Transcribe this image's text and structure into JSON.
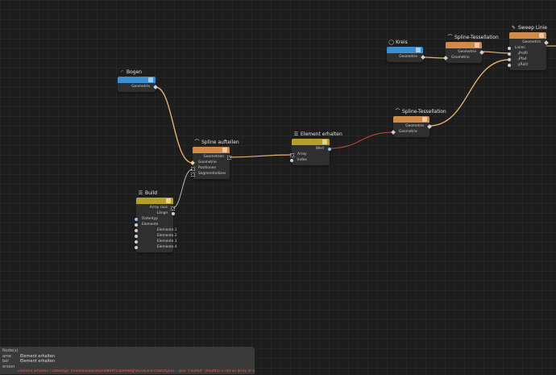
{
  "colors": {
    "geometry_header": "#d08a4a",
    "utility_header": "#b49f2a",
    "input_header": "#3a8fd0",
    "wire_geometry": "#e0b070",
    "wire_error": "#c04a40",
    "wire_neutral": "#b9b9b9"
  },
  "nodes": {
    "bogen": {
      "title": "Bogen",
      "icon": "arc-icon",
      "out_geometrie": "Geometrie"
    },
    "kreis": {
      "title": "Kreis",
      "icon": "circle-icon",
      "out_geometrie": "Geometrie"
    },
    "spline_tess_top": {
      "title": "Spline-Tessellation",
      "icon": "spline-icon",
      "out_geometrie": "Geometrie",
      "in_geometrie": "Geometrie"
    },
    "sweep": {
      "title": "Sweep Linie",
      "icon": "brush-icon",
      "out_geometrie": "Geometrie",
      "in_linien": "Linien",
      "in_profil": "Profil",
      "in_pfad": "Pfad",
      "in_rail": "(Rail)"
    },
    "spline_tess_mid": {
      "title": "Spline-Tessellation",
      "icon": "spline-icon",
      "out_geometrie": "Geometrie",
      "in_geometrie": "Geometrie"
    },
    "spline_aufteilen": {
      "title": "Spline aufteilen",
      "icon": "spline-icon",
      "out_geometrien": "Geometrien",
      "in_geometrie": "Geometrie",
      "in_positionen": "Positionen",
      "in_segmentindizes": "Segmentindizes"
    },
    "element_erhalten": {
      "title": "Element erhalten",
      "icon": "list-icon",
      "out_wert": "Wert",
      "in_array": "Array",
      "in_index": "Index"
    },
    "build": {
      "title": "Build",
      "icon": "list-icon",
      "out_array_raus": "Array raus",
      "out_laenge": "Länge",
      "in_datentyp": "Datentyp",
      "in_elemente": "Elemente",
      "in_elemente1": "Elemente.1",
      "in_elemente2": "Elemente.2",
      "in_elemente3": "Elemente.3",
      "in_elemente4": "Elemente.4"
    }
  },
  "status": {
    "header": "Node(s)",
    "name_key": "ame",
    "name_value": "Element erhalten",
    "label_key": "bel",
    "label_value": "Element erhalten",
    "version_key": "ersion",
    "version_value": "",
    "error_key": "",
    "error_value": "Element erhalten / Datentyp: (maxbauexecutionId80#f1ub9f88fgf2e23e3c0-c/datatype) - Type \"Float64\" (float64) is not an array or array container type."
  }
}
